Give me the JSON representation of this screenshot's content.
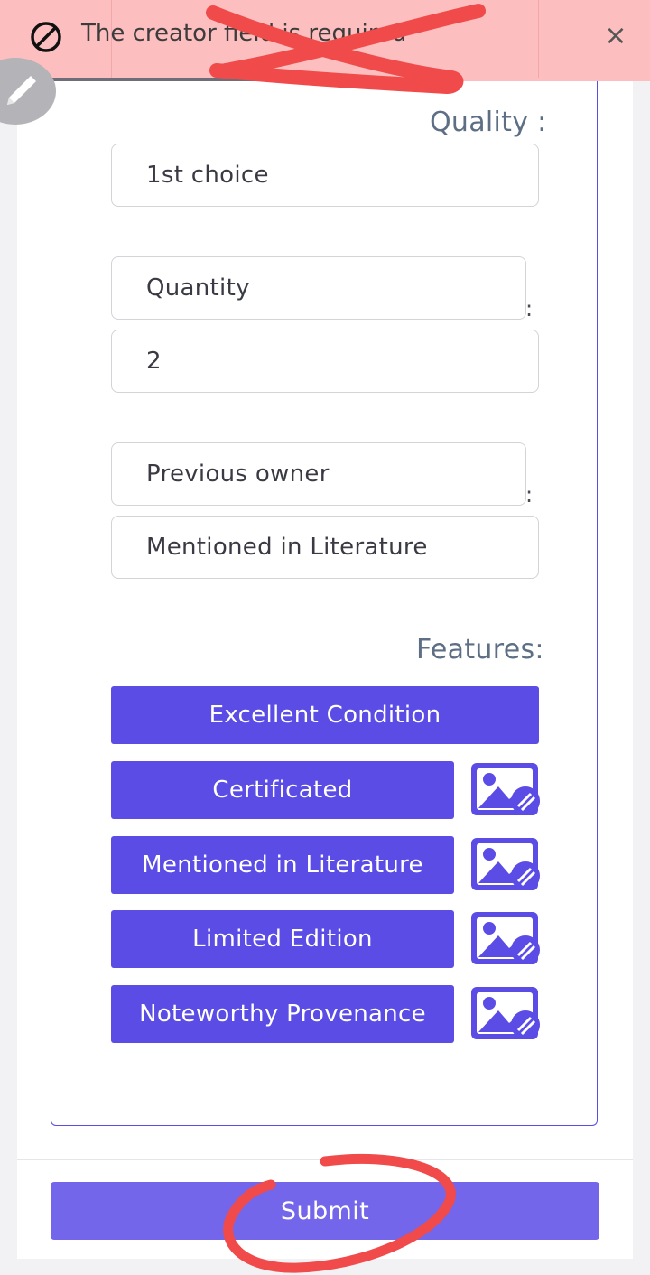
{
  "toast": {
    "message": "The creator field is required",
    "icon": "blocked-icon",
    "close_label": "×"
  },
  "form": {
    "quality_label": "Quality :",
    "quality_value": "1st choice",
    "quantity_key": "Quantity",
    "quantity_value": "2",
    "provenance_key": "Previous owner",
    "provenance_value": "Mentioned in Literature",
    "colon": ":",
    "features_label": "Features:",
    "features": [
      {
        "label": "Excellent Condition"
      },
      {
        "label": "Certificated"
      },
      {
        "label": "Mentioned in Literature"
      },
      {
        "label": "Limited Edition"
      },
      {
        "label": "Noteworthy Provenance"
      }
    ]
  },
  "submit_label": "Submit",
  "colors": {
    "accent": "#5b4ce6",
    "submit": "#7466ea",
    "toast_bg": "#fcbebe",
    "annotation": "#f04a4a"
  }
}
